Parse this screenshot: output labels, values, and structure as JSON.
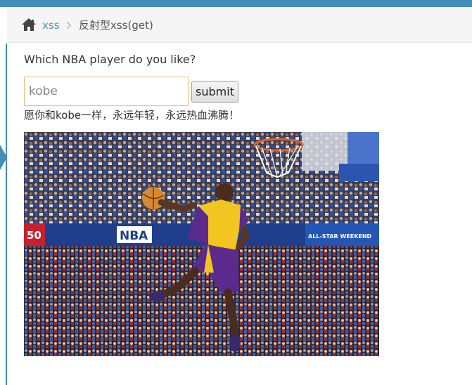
{
  "breadcrumb": {
    "home_icon": "home-icon",
    "link_label": "xss",
    "separator_icon": "chevron-right-icon",
    "current_label": "反射型xss(get)"
  },
  "form": {
    "question": "Which NBA player do you like?",
    "input_value": "kobe",
    "submit_label": "submit"
  },
  "result": {
    "message": "愿你和kobe一样，永远年轻，永远热血沸腾！"
  },
  "photo": {
    "banner_texts": [
      "NBA",
      "ALL-STAR WEEKEND",
      "50"
    ]
  },
  "colors": {
    "accent": "#438eb9",
    "link": "#4c8fbd",
    "input_border": "#f0b86a"
  }
}
